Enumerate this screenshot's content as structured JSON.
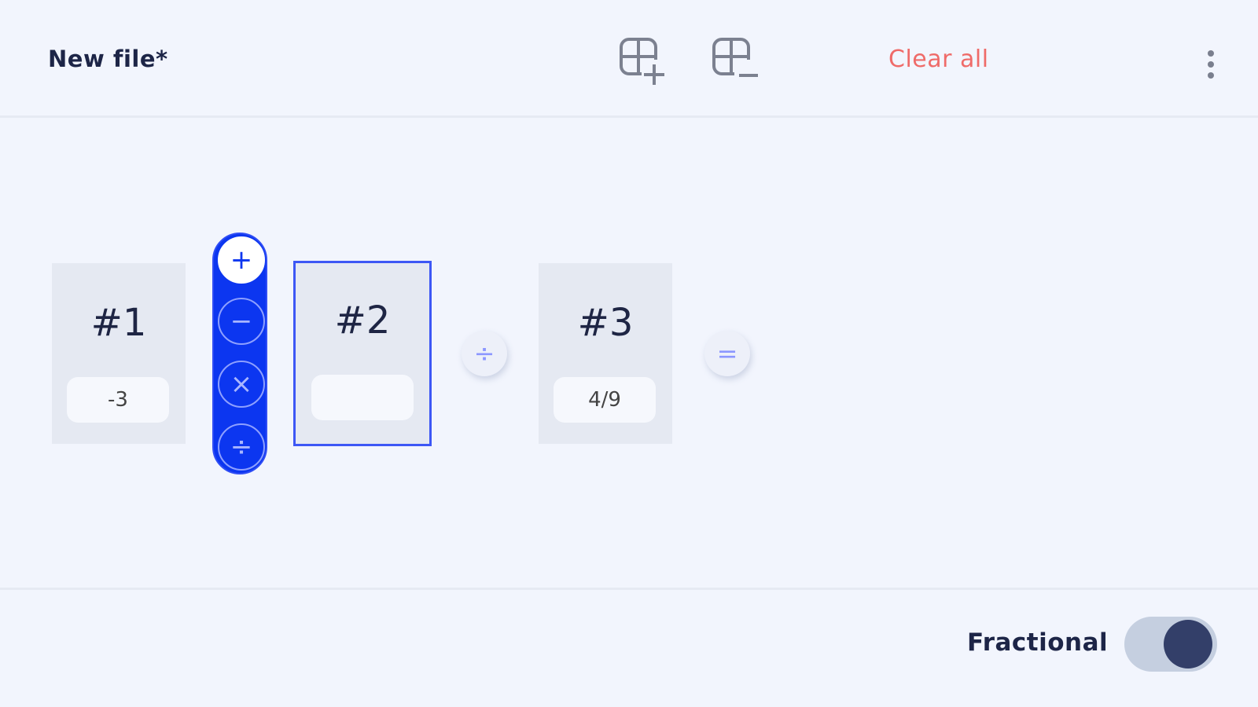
{
  "header": {
    "file_title": "New file*",
    "clear_all_label": "Clear all"
  },
  "workspace": {
    "cards": [
      {
        "label": "#1",
        "value": "-3"
      },
      {
        "label": "#2",
        "value": ""
      },
      {
        "label": "#3",
        "value": "4/9"
      }
    ],
    "operator_picker": {
      "options": [
        "+",
        "−",
        "×",
        "÷"
      ],
      "selected": "+"
    },
    "operators": [
      "÷",
      "="
    ]
  },
  "footer": {
    "toggle_label": "Fractional",
    "toggle_on": true
  },
  "colors": {
    "background": "#f2f5fd",
    "accent": "#0c36f0",
    "danger": "#ef6b69",
    "text": "#1d2547"
  }
}
